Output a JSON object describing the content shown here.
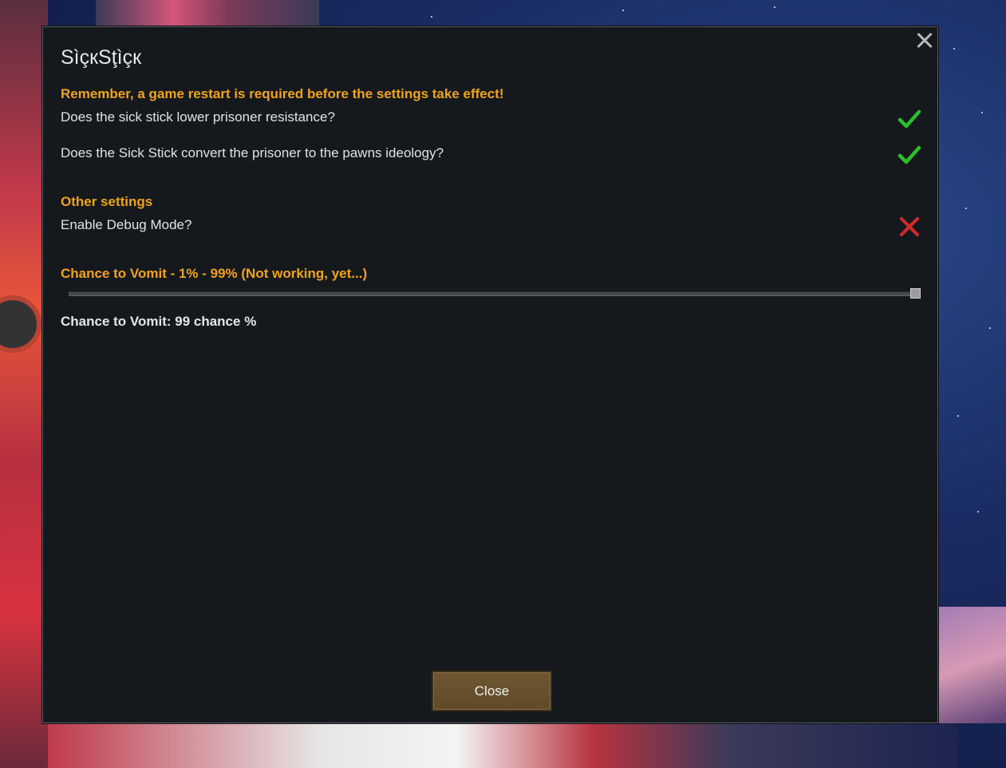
{
  "dialog": {
    "title": "SìçкSţìçк",
    "warning": "Remember, a game restart is required before the settings take effect!",
    "settings": [
      {
        "label": "Does the sick stick lower prisoner resistance?",
        "enabled": true
      },
      {
        "label": "Does the Sick Stick convert the prisoner to the pawns ideology?",
        "enabled": true
      }
    ],
    "other_header": "Other settings",
    "debug": {
      "label": "Enable Debug Mode?",
      "enabled": false
    },
    "vomit_header": "Chance to Vomit - 1% - 99% (Not working, yet...)",
    "vomit_slider": {
      "min": 1,
      "max": 99,
      "value": 99
    },
    "vomit_readout": "Chance to Vomit: 99 chance %",
    "close_label": "Close"
  },
  "colors": {
    "accent": "#f0a31c",
    "check_on": "#2bbf2b",
    "check_off": "#d42a2a",
    "panel": "#15191d",
    "button": "#6e5732"
  },
  "icons": {
    "close": "close-icon",
    "checked": "checkmark-icon",
    "unchecked": "cross-icon"
  }
}
